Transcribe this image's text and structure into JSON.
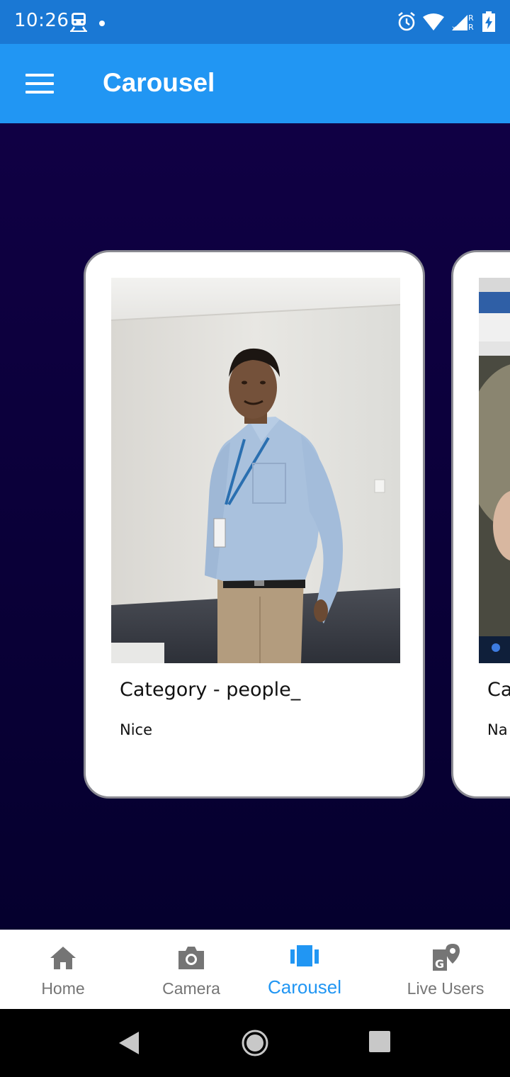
{
  "status_bar": {
    "time": "10:26",
    "icons": [
      "train-icon",
      "notification-dot-icon",
      "alarm-icon",
      "wifi-icon",
      "signal-icon",
      "battery-charging-icon"
    ],
    "roaming_marks": [
      "R",
      "R"
    ]
  },
  "app_bar": {
    "menu_icon": "hamburger-menu-icon",
    "title": "Carousel"
  },
  "carousel": {
    "cards": [
      {
        "title": "Category - people_",
        "description": "Nice",
        "image": "photo-person-standing"
      },
      {
        "title": "Ca",
        "description": "Na",
        "image": "photo-screen-and-hand"
      }
    ]
  },
  "bottom_nav": {
    "items": [
      {
        "label": "Home",
        "icon": "home-icon",
        "active": false
      },
      {
        "label": "Camera",
        "icon": "camera-icon",
        "active": false
      },
      {
        "label": "Carousel",
        "icon": "carousel-icon",
        "active": true
      },
      {
        "label": "Live Users",
        "icon": "map-location-icon",
        "active": false
      }
    ]
  },
  "system_nav": {
    "buttons": [
      "back-icon",
      "home-circle-icon",
      "recents-icon"
    ]
  },
  "colors": {
    "app_bar": "#2196f3",
    "status_bar": "#1a78d4",
    "background": "#0e0040",
    "active_nav": "#2196f3",
    "inactive_nav": "#757575"
  }
}
